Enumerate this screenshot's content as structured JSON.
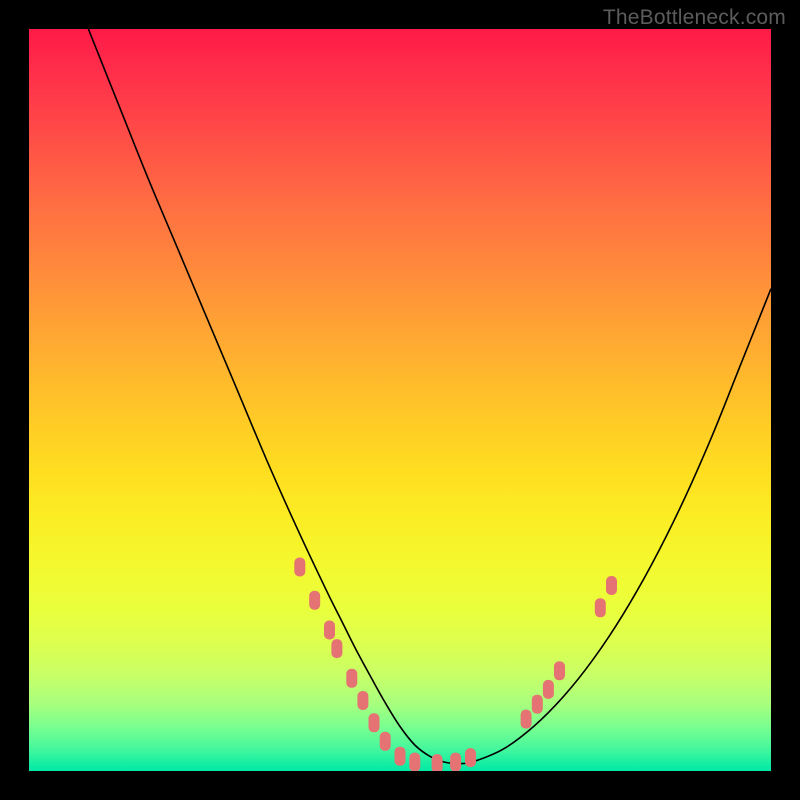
{
  "watermark": "TheBottleneck.com",
  "chart_data": {
    "type": "line",
    "title": "",
    "xlabel": "",
    "ylabel": "",
    "xlim": [
      0,
      100
    ],
    "ylim": [
      0,
      100
    ],
    "grid": false,
    "series": [
      {
        "name": "bottleneck-curve",
        "color": "#000000",
        "x": [
          8,
          12,
          16,
          20,
          24,
          28,
          32,
          36,
          40,
          42,
          44,
          46,
          48,
          50,
          52,
          54,
          56,
          58,
          60,
          64,
          68,
          72,
          76,
          80,
          84,
          88,
          92,
          96,
          100
        ],
        "y": [
          100,
          90,
          80,
          70.5,
          61,
          51.5,
          42,
          33,
          24.5,
          20.5,
          16.5,
          12.8,
          9.2,
          6,
          3.5,
          2,
          1.2,
          1,
          1.3,
          3,
          6,
          10,
          15,
          21,
          28,
          36,
          45,
          55,
          65
        ]
      }
    ],
    "markers": {
      "name": "highlight-points",
      "color": "#e57373",
      "shape": "rounded-rect",
      "points": [
        {
          "x": 36.5,
          "y": 27.5
        },
        {
          "x": 38.5,
          "y": 23
        },
        {
          "x": 40.5,
          "y": 19
        },
        {
          "x": 41.5,
          "y": 16.5
        },
        {
          "x": 43.5,
          "y": 12.5
        },
        {
          "x": 45,
          "y": 9.5
        },
        {
          "x": 46.5,
          "y": 6.5
        },
        {
          "x": 48,
          "y": 4
        },
        {
          "x": 50,
          "y": 2
        },
        {
          "x": 52,
          "y": 1.2
        },
        {
          "x": 55,
          "y": 1
        },
        {
          "x": 57.5,
          "y": 1.2
        },
        {
          "x": 59.5,
          "y": 1.8
        },
        {
          "x": 67,
          "y": 7
        },
        {
          "x": 68.5,
          "y": 9
        },
        {
          "x": 70,
          "y": 11
        },
        {
          "x": 71.5,
          "y": 13.5
        },
        {
          "x": 77,
          "y": 22
        },
        {
          "x": 78.5,
          "y": 25
        }
      ]
    },
    "background_gradient_stops": [
      {
        "pos": 0,
        "color": "#ff1a47"
      },
      {
        "pos": 50,
        "color": "#ffc728"
      },
      {
        "pos": 80,
        "color": "#e4ff45"
      },
      {
        "pos": 100,
        "color": "#03e9a5"
      }
    ]
  }
}
